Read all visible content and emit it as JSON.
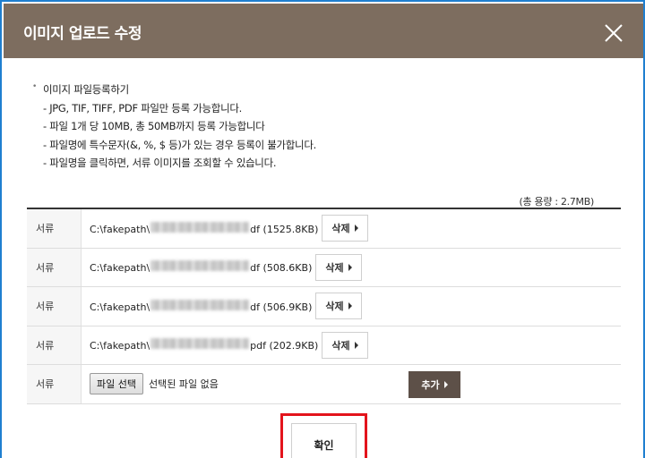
{
  "dialog": {
    "title": "이미지 업로드 수정",
    "close_icon": "close-icon"
  },
  "guide": {
    "title": "이미지 파일등록하기",
    "lines": [
      "- JPG, TIF, TIFF, PDF 파일만 등록 가능합니다.",
      "- 파일 1개 당 10MB, 총 50MB까지 등록 가능합니다",
      "- 파일명에 특수문자(&, %, $ 등)가 있는 경우 등록이 불가합니다.",
      "- 파일명을 클릭하면, 서류 이미지를 조회할 수 있습니다."
    ]
  },
  "total_size": "(총 용량 : 2.7MB)",
  "files": [
    {
      "label": "서류",
      "prefix": "C:\\fakepath\\",
      "suffix": "df (1525.8KB)",
      "delete_label": "삭제"
    },
    {
      "label": "서류",
      "prefix": "C:\\fakepath\\",
      "suffix": "df (508.6KB)",
      "delete_label": "삭제"
    },
    {
      "label": "서류",
      "prefix": "C:\\fakepath\\",
      "suffix": "df (506.9KB)",
      "delete_label": "삭제"
    },
    {
      "label": "서류",
      "prefix": "C:\\fakepath\\",
      "suffix": "pdf (202.9KB)",
      "delete_label": "삭제"
    }
  ],
  "new_file": {
    "label": "서류",
    "choose_label": "파일 선택",
    "status": "선택된 파일 없음",
    "add_label": "추가"
  },
  "confirm_label": "확인",
  "colors": {
    "header_bg": "#7d6d5f",
    "add_button_bg": "#5d5048",
    "highlight_border": "#e3141c",
    "window_border": "#1f7fd0"
  }
}
